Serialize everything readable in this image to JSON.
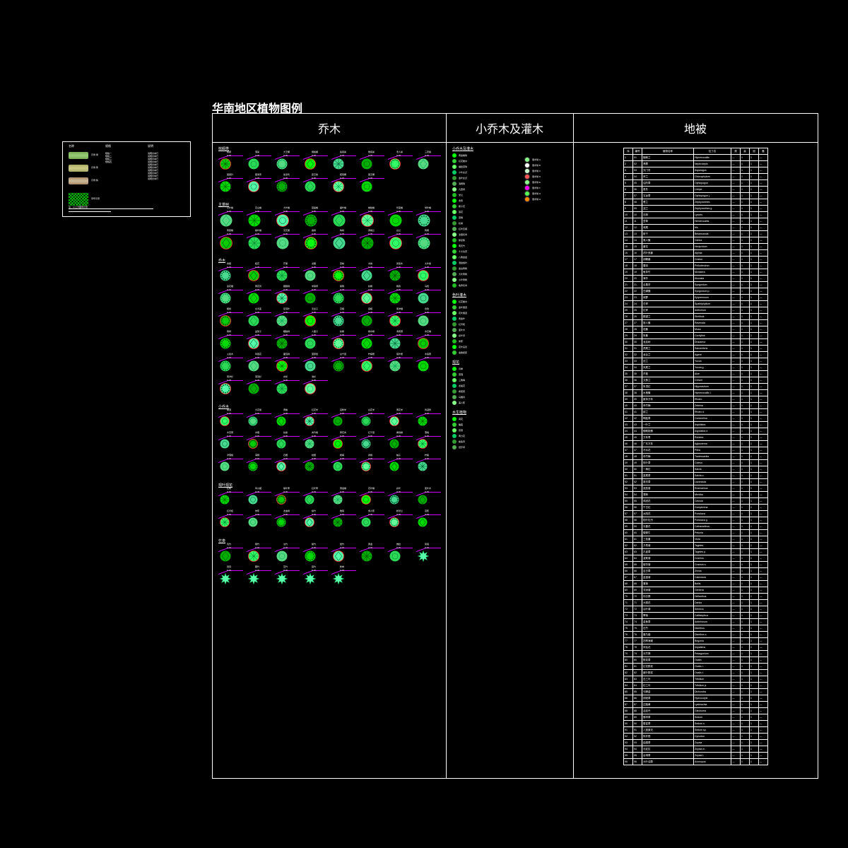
{
  "title": "华南地区植物图例",
  "headers": {
    "col1": "乔木",
    "col2": "小乔木及灌木",
    "col3": "地被"
  },
  "thumb": {
    "sections": [
      "名称",
      "规格",
      "说明"
    ],
    "swatches": [
      {
        "color": "linear-gradient(#7a5,#9c7,#7a5)",
        "label": "示例 绿"
      },
      {
        "color": "linear-gradient(#aa6,#cc8,#aa6)",
        "label": "示例 黄"
      },
      {
        "color": "linear-gradient(#a86,#cb9,#a86)",
        "label": "示例 棕"
      }
    ],
    "speclist": [
      "规格一",
      "规格二",
      "规格三",
      "规格四"
    ],
    "notelist": [
      "说明文本行",
      "说明文本行",
      "说明文本行",
      "说明文本行",
      "说明文本行",
      "说明文本行",
      "说明文本行",
      "说明文本行",
      "说明文本行",
      "说明文本行"
    ],
    "hatchlabel": "草坪示意",
    "footer": "注：以上为图例示意"
  },
  "tree_sections": [
    {
      "name": "棕榈类",
      "count": 14,
      "labels": [
        "棕榈",
        "蒲葵",
        "大王椰",
        "假槟榔",
        "鱼尾葵",
        "散尾葵",
        "老人葵",
        "三药槟",
        "美丽针",
        "银海枣",
        "加拿利",
        "霸王棕",
        "狐尾椰",
        "国王椰"
      ]
    },
    {
      "name": "主景树",
      "count": 16,
      "labels": [
        "小叶榕",
        "高山榕",
        "大叶榕",
        "菩提榕",
        "垂叶榕",
        "橡胶榕",
        "印度榕",
        "琴叶榕",
        "黄葛榕",
        "柳叶榕",
        "无花果",
        "桑树",
        "构树",
        "黄桷兰",
        "白兰",
        "刺桐"
      ]
    },
    {
      "name": "乔木",
      "count": 44,
      "labels": [
        "香樟",
        "桂花",
        "芒果",
        "龙眼",
        "荔枝",
        "木棉",
        "凤凰木",
        "大叶紫",
        "蓝花楹",
        "黄花风",
        "腊肠树",
        "羊蹄甲",
        "紫荆",
        "秋枫",
        "枫香",
        "乌桕",
        "樟树",
        "台湾栾",
        "复羽叶",
        "无患子",
        "苦楝",
        "麻楝",
        "南洋楹",
        "合欢",
        "雨树",
        "盆架子",
        "糖胶树",
        "人面子",
        "秋枫",
        "幌伞枫",
        "海南蒲",
        "水石榕",
        "火焰木",
        "鸡蛋花",
        "面包树",
        "菠萝蜜",
        "白千层",
        "柠檬桉",
        "尾叶桉",
        "木麻黄",
        "南洋杉",
        "落羽杉",
        "水松",
        "池杉"
      ]
    },
    {
      "name": "小乔木",
      "count": 24,
      "labels": [
        "紫薇",
        "大花紫",
        "黄槐",
        "红花羊",
        "宫粉羊",
        "白花羊",
        "黄花羊",
        "鸡冠刺",
        "木芙蓉",
        "木槿",
        "扶桑",
        "夹竹桃",
        "黄花夹",
        "红千层",
        "串钱柳",
        "蒲桃",
        "洋蒲桃",
        "海桐",
        "石榴",
        "枇杷",
        "杨梅",
        "香橼",
        "柚子",
        "柠檬"
      ]
    },
    {
      "name": "观叶观花",
      "count": 16,
      "labels": [
        "红枫",
        "鸡爪槭",
        "紫叶李",
        "红叶李",
        "黄金榕",
        "花叶榕",
        "彩叶",
        "变叶木",
        "红背桂",
        "朱蕉",
        "龙血树",
        "棕竹",
        "散尾",
        "旅人蕉",
        "鹤望兰",
        "芭蕉"
      ]
    },
    {
      "name": "竹类",
      "count": 13,
      "labels": [
        "毛竹",
        "刚竹",
        "淡竹",
        "紫竹",
        "斑竹",
        "黄金",
        "佛肚",
        "凤尾",
        "观音",
        "箬竹",
        "苦竹",
        "麻竹",
        "粉单"
      ]
    }
  ],
  "shrub_sections": [
    {
      "name": "小乔木及灌木",
      "items": [
        "黄金榕球",
        "红花檵木",
        "福建茶球",
        "小叶女贞",
        "金叶女贞",
        "海桐球",
        "九里香",
        "米兰",
        "含笑",
        "栀子花",
        "茶花",
        "茶梅",
        "杜鹃",
        "红叶石楠",
        "法国冬青",
        "鹅掌柴",
        "南天竹",
        "十大功劳",
        "八角金盘",
        "洒金桃叶",
        "金边黄杨",
        "大叶黄杨",
        "小叶黄杨",
        "龟甲冬青"
      ],
      "right": [
        {
          "color": "#8f8",
          "label": "灌木球 A"
        },
        {
          "color": "#fff",
          "label": "灌木球 B"
        },
        {
          "color": "#cfc",
          "label": "灌木球 C"
        },
        {
          "color": "#f55",
          "label": "灌木球 D"
        },
        {
          "color": "#8f8",
          "label": "灌木球 E"
        },
        {
          "color": "#f0f",
          "label": "灌木球 F"
        },
        {
          "color": "#5f5",
          "label": "灌木球 G"
        },
        {
          "color": "#f80",
          "label": "灌木球 H"
        }
      ]
    },
    {
      "name": "色叶灌木",
      "items": [
        "红花檵木",
        "金叶假连",
        "花叶假连",
        "黄金叶",
        "红背桂",
        "变叶木",
        "彩叶草",
        "朱蕉",
        "花叶良姜",
        "金脉爵床"
      ]
    },
    {
      "name": "观花",
      "items": [
        "月季",
        "蔷薇",
        "三角梅",
        "龙船花",
        "希茉莉",
        "马缨丹",
        "美人蕉"
      ]
    },
    {
      "name": "水生植物",
      "items": [
        "荷花",
        "睡莲",
        "菖蒲",
        "再力花",
        "梭鱼草",
        "纸莎草"
      ]
    }
  ],
  "table": {
    "headers": [
      "序",
      "编号",
      "植物名称",
      "拉丁名",
      "规",
      "高",
      "冠",
      "备"
    ],
    "rows": [
      [
        "1",
        "01",
        "蜘蛛兰",
        "Hymenocallis",
        "—",
        "1",
        "1",
        "—"
      ],
      [
        "2",
        "02",
        "肾蕨",
        "Nephrolepis",
        "—",
        "1",
        "1",
        "—"
      ],
      [
        "3",
        "03",
        "天门冬",
        "Asparagus",
        "—",
        "1",
        "1",
        "—"
      ],
      [
        "4",
        "04",
        "吊兰",
        "Chlorophytum",
        "—",
        "1",
        "1",
        "—"
      ],
      [
        "5",
        "05",
        "沿阶草",
        "Ophiopogon",
        "—",
        "1",
        "1",
        "—"
      ],
      [
        "6",
        "06",
        "麦冬",
        "Liriope",
        "—",
        "1",
        "1",
        "—"
      ],
      [
        "7",
        "07",
        "玉龙草",
        "Ophiopogon j.",
        "—",
        "1",
        "1",
        "—"
      ],
      [
        "8",
        "08",
        "葱兰",
        "Zephyranthes",
        "—",
        "1",
        "1",
        "—"
      ],
      [
        "9",
        "09",
        "韭兰",
        "Zephyranthes g.",
        "—",
        "1",
        "1",
        "—"
      ],
      [
        "10",
        "10",
        "石蒜",
        "Lycoris",
        "—",
        "1",
        "1",
        "—"
      ],
      [
        "11",
        "11",
        "萱草",
        "Hemerocallis",
        "—",
        "1",
        "1",
        "—"
      ],
      [
        "12",
        "12",
        "鸢尾",
        "Iris",
        "—",
        "1",
        "1",
        "—"
      ],
      [
        "13",
        "13",
        "射干",
        "Belamcanda",
        "—",
        "1",
        "1",
        "—"
      ],
      [
        "14",
        "14",
        "美人蕉",
        "Canna",
        "—",
        "1",
        "1",
        "—"
      ],
      [
        "15",
        "15",
        "姜花",
        "Hedychium",
        "—",
        "1",
        "1",
        "—"
      ],
      [
        "16",
        "16",
        "花叶良姜",
        "Alpinia",
        "—",
        "1",
        "1",
        "—"
      ],
      [
        "17",
        "17",
        "闭鞘姜",
        "Costus",
        "—",
        "1",
        "1",
        "—"
      ],
      [
        "18",
        "18",
        "春羽",
        "Philodendron",
        "—",
        "1",
        "1",
        "—"
      ],
      [
        "19",
        "19",
        "龟背竹",
        "Monstera",
        "—",
        "1",
        "1",
        "—"
      ],
      [
        "20",
        "20",
        "海芋",
        "Alocasia",
        "—",
        "1",
        "1",
        "—"
      ],
      [
        "21",
        "21",
        "合果芋",
        "Syngonium",
        "—",
        "1",
        "1",
        "—"
      ],
      [
        "22",
        "22",
        "白蝴蝶",
        "Syngonium p.",
        "—",
        "1",
        "1",
        "—"
      ],
      [
        "23",
        "23",
        "绿萝",
        "Epipremnum",
        "—",
        "1",
        "1",
        "—"
      ],
      [
        "24",
        "24",
        "白掌",
        "Spathiphyllum",
        "—",
        "1",
        "1",
        "—"
      ],
      [
        "25",
        "25",
        "红掌",
        "Anthurium",
        "—",
        "1",
        "1",
        "—"
      ],
      [
        "26",
        "26",
        "鹤望兰",
        "Strelitzia",
        "—",
        "1",
        "1",
        "—"
      ],
      [
        "27",
        "27",
        "旅人蕉",
        "Ravenala",
        "—",
        "1",
        "1",
        "—"
      ],
      [
        "28",
        "28",
        "芭蕉",
        "Musa",
        "—",
        "1",
        "1",
        "—"
      ],
      [
        "29",
        "29",
        "朱蕉",
        "Cordyline",
        "—",
        "1",
        "1",
        "—"
      ],
      [
        "30",
        "30",
        "龙血树",
        "Dracaena",
        "—",
        "1",
        "1",
        "—"
      ],
      [
        "31",
        "31",
        "虎尾兰",
        "Sansevieria",
        "—",
        "1",
        "1",
        "—"
      ],
      [
        "32",
        "32",
        "龙舌兰",
        "Agave",
        "—",
        "1",
        "1",
        "—"
      ],
      [
        "33",
        "33",
        "丝兰",
        "Yucca",
        "—",
        "1",
        "1",
        "—"
      ],
      [
        "34",
        "34",
        "凤尾兰",
        "Yucca g.",
        "—",
        "1",
        "1",
        "—"
      ],
      [
        "35",
        "35",
        "芦荟",
        "Aloe",
        "—",
        "1",
        "1",
        "—"
      ],
      [
        "36",
        "36",
        "文殊兰",
        "Crinum",
        "—",
        "1",
        "1",
        "—"
      ],
      [
        "37",
        "37",
        "朱顶红",
        "Hippeastrum",
        "—",
        "1",
        "1",
        "—"
      ],
      [
        "38",
        "38",
        "水鬼蕉",
        "Hymenocallis l.",
        "—",
        "1",
        "1",
        "—"
      ],
      [
        "39",
        "39",
        "紫背万年",
        "Rhoeo",
        "—",
        "1",
        "1",
        "—"
      ],
      [
        "40",
        "40",
        "吊竹梅",
        "Zebrina",
        "—",
        "1",
        "1",
        "—"
      ],
      [
        "41",
        "41",
        "蚌兰",
        "Rhoeo d.",
        "—",
        "1",
        "1",
        "—"
      ],
      [
        "42",
        "42",
        "鸭跖草",
        "Commelina",
        "—",
        "1",
        "1",
        "—"
      ],
      [
        "43",
        "43",
        "一叶兰",
        "Aspidistra",
        "—",
        "1",
        "1",
        "—"
      ],
      [
        "44",
        "44",
        "蜘蛛抱蛋",
        "Aspidistra e.",
        "—",
        "1",
        "1",
        "—"
      ],
      [
        "45",
        "45",
        "万年青",
        "Rohdea",
        "—",
        "1",
        "1",
        "—"
      ],
      [
        "46",
        "46",
        "广东万年",
        "Aglaonema",
        "—",
        "1",
        "1",
        "—"
      ],
      [
        "47",
        "47",
        "冷水花",
        "Pilea",
        "—",
        "1",
        "1",
        "—"
      ],
      [
        "48",
        "48",
        "吊竹梅",
        "Tradescantia",
        "—",
        "1",
        "1",
        "—"
      ],
      [
        "49",
        "49",
        "彩叶草",
        "Coleus",
        "—",
        "1",
        "1",
        "—"
      ],
      [
        "50",
        "50",
        "一串红",
        "Salvia",
        "—",
        "1",
        "1",
        "—"
      ],
      [
        "51",
        "51",
        "鼠尾草",
        "Salvia o.",
        "—",
        "1",
        "1",
        "—"
      ],
      [
        "52",
        "52",
        "薰衣草",
        "Lavandula",
        "—",
        "1",
        "1",
        "—"
      ],
      [
        "53",
        "53",
        "迷迭香",
        "Rosmarinus",
        "—",
        "1",
        "1",
        "—"
      ],
      [
        "54",
        "54",
        "薄荷",
        "Mentha",
        "—",
        "1",
        "1",
        "—"
      ],
      [
        "55",
        "55",
        "鸡冠花",
        "Celosia",
        "—",
        "1",
        "1",
        "—"
      ],
      [
        "56",
        "56",
        "千日红",
        "Gomphrena",
        "—",
        "1",
        "1",
        "—"
      ],
      [
        "57",
        "57",
        "太阳花",
        "Portulaca",
        "—",
        "1",
        "1",
        "—"
      ],
      [
        "58",
        "58",
        "松叶牡丹",
        "Portulaca g.",
        "—",
        "1",
        "1",
        "—"
      ],
      [
        "59",
        "59",
        "长春花",
        "Catharanthus",
        "—",
        "1",
        "1",
        "—"
      ],
      [
        "60",
        "60",
        "矮牵牛",
        "Petunia",
        "—",
        "1",
        "1",
        "—"
      ],
      [
        "61",
        "61",
        "三色堇",
        "Viola",
        "—",
        "1",
        "1",
        "—"
      ],
      [
        "62",
        "62",
        "万寿菊",
        "Tagetes",
        "—",
        "1",
        "1",
        "—"
      ],
      [
        "63",
        "63",
        "孔雀草",
        "Tagetes p.",
        "—",
        "1",
        "1",
        "—"
      ],
      [
        "64",
        "64",
        "波斯菊",
        "Cosmos",
        "—",
        "1",
        "1",
        "—"
      ],
      [
        "65",
        "65",
        "硫华菊",
        "Cosmos s.",
        "—",
        "1",
        "1",
        "—"
      ],
      [
        "66",
        "66",
        "百日草",
        "Zinnia",
        "—",
        "1",
        "1",
        "—"
      ],
      [
        "67",
        "67",
        "金盏菊",
        "Calendula",
        "—",
        "1",
        "1",
        "—"
      ],
      [
        "68",
        "68",
        "雏菊",
        "Bellis",
        "—",
        "1",
        "1",
        "—"
      ],
      [
        "69",
        "69",
        "非洲菊",
        "Gerbera",
        "—",
        "1",
        "1",
        "—"
      ],
      [
        "70",
        "70",
        "向日葵",
        "Helianthus",
        "—",
        "1",
        "1",
        "—"
      ],
      [
        "71",
        "71",
        "大丽花",
        "Dahlia",
        "—",
        "1",
        "1",
        "—"
      ],
      [
        "72",
        "72",
        "瓜叶菊",
        "Senecio",
        "—",
        "1",
        "1",
        "—"
      ],
      [
        "73",
        "73",
        "翠菊",
        "Callistephus",
        "—",
        "1",
        "1",
        "—"
      ],
      [
        "74",
        "74",
        "金鱼草",
        "Antirrhinum",
        "—",
        "1",
        "1",
        "—"
      ],
      [
        "75",
        "75",
        "石竹",
        "Dianthus",
        "—",
        "1",
        "1",
        "—"
      ],
      [
        "76",
        "76",
        "康乃馨",
        "Dianthus c.",
        "—",
        "1",
        "1",
        "—"
      ],
      [
        "77",
        "77",
        "四季海棠",
        "Begonia",
        "—",
        "1",
        "1",
        "—"
      ],
      [
        "78",
        "78",
        "凤仙花",
        "Impatiens",
        "—",
        "1",
        "1",
        "—"
      ],
      [
        "79",
        "79",
        "天竺葵",
        "Pelargonium",
        "—",
        "1",
        "1",
        "—"
      ],
      [
        "80",
        "80",
        "酢浆草",
        "Oxalis",
        "—",
        "1",
        "1",
        "—"
      ],
      [
        "81",
        "81",
        "红花酢浆",
        "Oxalis r.",
        "—",
        "1",
        "1",
        "—"
      ],
      [
        "82",
        "82",
        "紫叶酢浆",
        "Oxalis t.",
        "—",
        "1",
        "1",
        "—"
      ],
      [
        "83",
        "83",
        "白三叶",
        "Trifolium",
        "—",
        "1",
        "1",
        "—"
      ],
      [
        "84",
        "84",
        "红三叶",
        "Trifolium p.",
        "—",
        "1",
        "1",
        "—"
      ],
      [
        "85",
        "85",
        "马蹄金",
        "Dichondra",
        "—",
        "1",
        "1",
        "—"
      ],
      [
        "86",
        "86",
        "铜钱草",
        "Hydrocotyle",
        "—",
        "1",
        "1",
        "—"
      ],
      [
        "87",
        "87",
        "过路黄",
        "Lysimachia",
        "—",
        "1",
        "1",
        "—"
      ],
      [
        "88",
        "88",
        "活血丹",
        "Glechoma",
        "—",
        "1",
        "1",
        "—"
      ],
      [
        "89",
        "89",
        "佛甲草",
        "Sedum",
        "—",
        "1",
        "1",
        "—"
      ],
      [
        "90",
        "90",
        "垂盆草",
        "Sedum s.",
        "—",
        "1",
        "1",
        "—"
      ],
      [
        "91",
        "91",
        "八宝景天",
        "Sedum sp.",
        "—",
        "1",
        "1",
        "—"
      ],
      [
        "92",
        "92",
        "狗牙根",
        "Cynodon",
        "—",
        "1",
        "1",
        "—"
      ],
      [
        "93",
        "93",
        "结缕草",
        "Zoysia",
        "—",
        "1",
        "1",
        "—"
      ],
      [
        "94",
        "94",
        "马尼拉",
        "Zoysia m.",
        "—",
        "1",
        "1",
        "—"
      ],
      [
        "95",
        "95",
        "台湾草",
        "Zoysia t.",
        "—",
        "1",
        "1",
        "—"
      ],
      [
        "96",
        "96",
        "大叶油草",
        "Axonopus",
        "—",
        "1",
        "1",
        "—"
      ]
    ]
  }
}
